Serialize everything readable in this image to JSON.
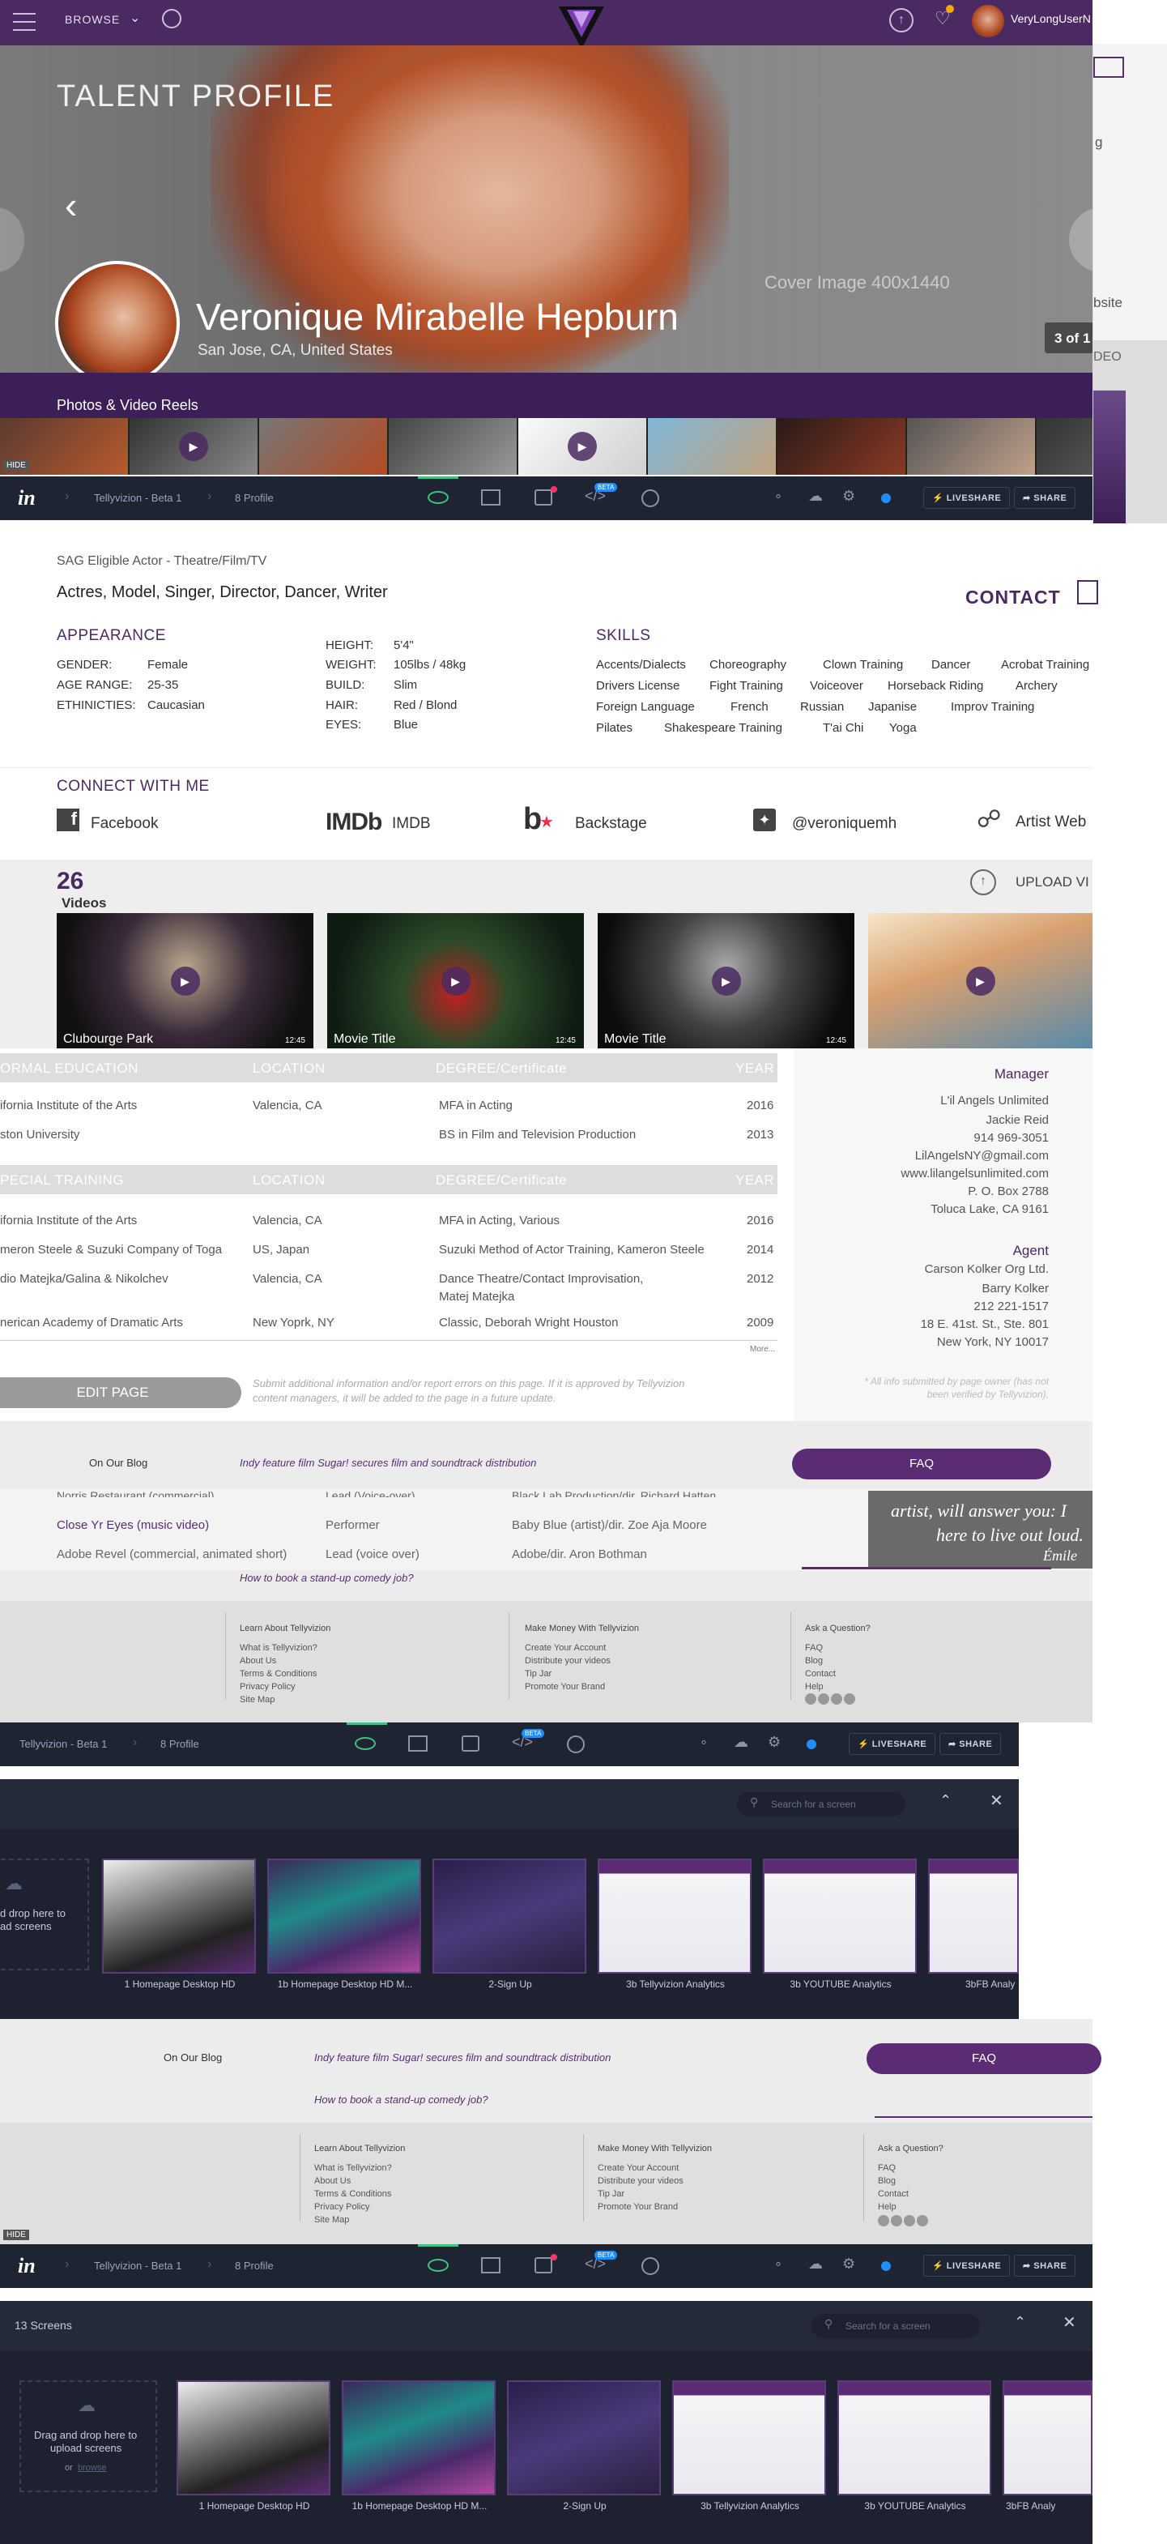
{
  "topnav": {
    "browse": "BROWSE",
    "username": "VeryLongUserN"
  },
  "hero": {
    "section_title": "TALENT PROFILE",
    "name": "Veronique Mirabelle Hepburn",
    "location": "San Jose, CA, United States",
    "cover_note": "Cover Image 400x1440",
    "counter": "3 of 1",
    "reels_label": "Photos & Video Reels",
    "hide": "HIDE"
  },
  "side": {
    "g": "g",
    "bsite": "bsite",
    "deo": "DEO"
  },
  "invision": {
    "project": "Tellyvizion - Beta 1",
    "screen": "8 Profile",
    "beta": "BETA",
    "liveshare": "LIVESHARE",
    "share": "SHARE"
  },
  "profile": {
    "guild": "SAG Eligible Actor - Theatre/Film/TV",
    "roles": "Actres, Model, Singer, Director, Dancer, Writer",
    "contact": "CONTACT",
    "appearance_title": "APPEARANCE",
    "gender_label": "GENDER:",
    "gender": "Female",
    "age_label": "AGE RANGE:",
    "age": "25-35",
    "eth_label": "ETHINICTIES:",
    "eth": "Caucasian",
    "height_label": "HEIGHT:",
    "height": "5'4\"",
    "weight_label": "WEIGHT:",
    "weight": "105lbs / 48kg",
    "build_label": "BUILD:",
    "build": "Slim",
    "hair_label": "HAIR:",
    "hair": "Red / Blond",
    "eyes_label": "EYES:",
    "eyes": "Blue",
    "skills_title": "SKILLS",
    "skills_row1": [
      "Accents/Dialects",
      "Choreography",
      "Clown Training",
      "Dancer",
      "Acrobat Training"
    ],
    "skills_row2": [
      "Drivers License",
      "Fight Training",
      "Voiceover",
      "Horseback Riding",
      "Archery"
    ],
    "skills_row3": [
      "Foreign Language",
      "French",
      "Russian",
      "Japanise",
      "Improv Training"
    ],
    "skills_row4": [
      "Pilates",
      "Shakespeare Training",
      "T'ai Chi",
      "Yoga"
    ]
  },
  "connect": {
    "title": "CONNECT WITH ME",
    "facebook": "Facebook",
    "imdb_logo": "IMDb",
    "imdb": "IMDB",
    "backstage_logo": "b",
    "backstage": "Backstage",
    "twitter": "@veroniquemh",
    "website": "Artist Web"
  },
  "videos": {
    "count": "26",
    "label": "Videos",
    "upload": "UPLOAD VI",
    "items": [
      {
        "title": "Clubourge Park",
        "time": "12:45"
      },
      {
        "title": "Movie Title",
        "time": "12:45"
      },
      {
        "title": "Movie Title",
        "time": "12:45"
      },
      {
        "title": "",
        "time": ""
      }
    ]
  },
  "education": {
    "formal_header": [
      "ORMAL EDUCATION",
      "LOCATION",
      "DEGREE/Certificate",
      "YEAR"
    ],
    "formal_rows": [
      [
        "ifornia Institute of the Arts",
        "Valencia, CA",
        "MFA in Acting",
        "2016"
      ],
      [
        "ston University",
        "",
        "BS in Film and Television Production",
        "2013"
      ]
    ],
    "special_header": [
      "PECIAL TRAINING",
      "LOCATION",
      "DEGREE/Certificate",
      "YEAR"
    ],
    "special_rows": [
      [
        "ifornia Institute of the Arts",
        "Valencia, CA",
        "MFA in Acting, Various",
        "2016"
      ],
      [
        "meron Steele & Suzuki Company of Toga",
        "US, Japan",
        "Suzuki Method of Actor Training, Kameron Steele",
        "2014"
      ],
      [
        "dio Matejka/Galina & Nikolchev",
        "Valencia, CA",
        "Dance Theatre/Contact Improvisation,",
        "2012"
      ],
      [
        "",
        "",
        "Matej Matejka",
        ""
      ],
      [
        "nerican Academy of Dramatic Arts",
        "New Yoprk, NY",
        "Classic, Deborah Wright Houston",
        "2009"
      ]
    ],
    "more": "More...",
    "edit_button": "EDIT PAGE",
    "edit_note_1": "Submit additional information and/or report errors on this page. If it is approved by Tellyvizion",
    "edit_note_2": "content managers, it will be added to the page in a future update.",
    "verify_note_1": "* All  info submitted by page owner (has not",
    "verify_note_2": "been verified by Tellyvizion)."
  },
  "agents": {
    "manager_title": "Manager",
    "manager": [
      "L'il Angels Unlimited",
      "Jackie Reid",
      "914 969-3051",
      "LilAngelsNY@gmail.com",
      "www.lilangelsunlimited.com",
      "P. O. Box 2788",
      "Toluca Lake, CA 9161"
    ],
    "agent_title": "Agent",
    "agent": [
      "Carson Kolker Org Ltd.",
      "Barry Kolker",
      "212 221-1517",
      "18 E. 41st. St., Ste. 801",
      "New York, NY 10017"
    ]
  },
  "blog": {
    "label": "On Our Blog",
    "post1": "Indy feature film Sugar! secures film and soundtrack distribution",
    "post2": "How to book a stand-up comedy job?",
    "faq": "FAQ",
    "credits": [
      [
        "Norris Restaurant (commercial)",
        "Lead (Voice-over)",
        "Black Lab Production/dir. Richard Hatten"
      ],
      [
        "Close Yr Eyes (music video)",
        "Performer",
        "Baby Blue (artist)/dir. Zoe Aja Moore"
      ],
      [
        "Adobe Revel (commercial, animated short)",
        "Lead (voice over)",
        "Adobe/dir. Aron Bothman"
      ]
    ],
    "quote1": "artist, will answer you: I",
    "quote2": "here to live out loud.",
    "quote3": "Émile"
  },
  "footer": {
    "col1_title": "Learn About Tellyvizion",
    "col1": [
      "What is Tellyvizion?",
      "About Us",
      "Terms & Conditions",
      "Privacy Policy",
      "Site Map"
    ],
    "col2_title": "Make Money With Tellyvizion",
    "col2": [
      "Create Your Account",
      "Distribute your videos",
      "Tip Jar",
      "Promote Your Brand"
    ],
    "col3_title": "Ask a Question?",
    "col3": [
      "FAQ",
      "Blog",
      "Contact",
      "Help"
    ]
  },
  "screens": {
    "search_placeholder": "Search for a screen",
    "count_title": "13 Screens",
    "drag_text_1": "d drop here to",
    "drag_text_2": "ad screens",
    "drag_full_1": "Drag and drop here to",
    "drag_full_2": "upload screens",
    "drag_or": "or",
    "drag_browse": "browse",
    "labels": [
      "1 Homepage Desktop HD",
      "1b Homepage Desktop HD M...",
      "2-Sign Up",
      "3b Tellyvizion Analytics",
      "3b YOUTUBE Analytics",
      "3bFB Analy"
    ]
  },
  "colors": {
    "brand": "#4b2a63",
    "accent": "#5b2c74",
    "invision": "#1f2433"
  }
}
